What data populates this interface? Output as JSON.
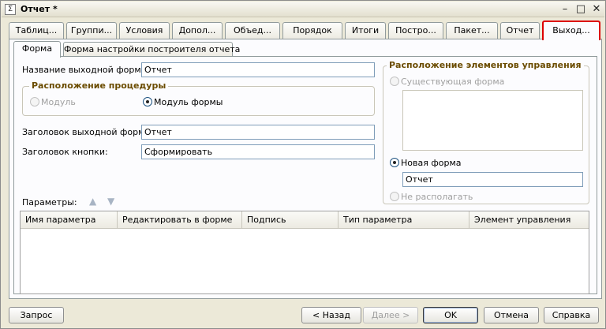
{
  "window": {
    "title": "Отчет *",
    "icon_glyph": "Σ",
    "minimize_glyph": "–",
    "maximize_glyph": "□",
    "close_glyph": "✕"
  },
  "tabs": [
    {
      "label": "Таблиц..."
    },
    {
      "label": "Группи..."
    },
    {
      "label": "Условия"
    },
    {
      "label": "Допол..."
    },
    {
      "label": "Объед..."
    },
    {
      "label": "Порядок"
    },
    {
      "label": "Итоги"
    },
    {
      "label": "Постро..."
    },
    {
      "label": "Пакет..."
    },
    {
      "label": "Отчет"
    },
    {
      "label": "Выход..."
    }
  ],
  "subtabs": [
    {
      "label": "Форма"
    },
    {
      "label": "Форма настройки построителя отчета"
    }
  ],
  "form": {
    "output_form_name_label": "Название выходной формы:",
    "output_form_name_value": "Отчет",
    "procedure_group_title": "Расположение процедуры",
    "radio_module_label": "Модуль",
    "radio_form_module_label": "Модуль формы",
    "output_form_header_label": "Заголовок выходной формы:",
    "output_form_header_value": "Отчет",
    "button_header_label": "Заголовок кнопки:",
    "button_header_value": "Сформировать",
    "parameters_label": "Параметры:",
    "up_arrow_glyph": "▲",
    "down_arrow_glyph": "▼"
  },
  "controls_group": {
    "title": "Расположение элементов управления",
    "existing_form_label": "Существующая форма",
    "new_form_label": "Новая форма",
    "new_form_value": "Отчет",
    "no_place_label": "Не располагать"
  },
  "grid": {
    "columns": [
      "Имя параметра",
      "Редактировать в форме",
      "Подпись",
      "Тип параметра",
      "Элемент управления"
    ]
  },
  "buttons": {
    "query": "Запрос",
    "back": "< Назад",
    "next": "Далее >",
    "ok": "OK",
    "cancel": "Отмена",
    "help": "Справка"
  },
  "colors": {
    "active_tab_highlight": "#DD0000",
    "group_title": "#6B4C00"
  }
}
